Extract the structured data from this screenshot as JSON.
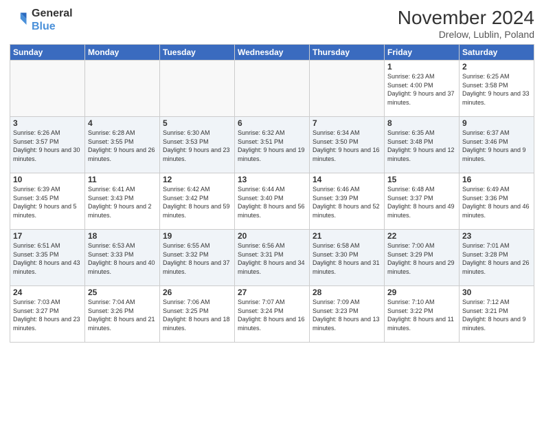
{
  "logo": {
    "line1": "General",
    "line2": "Blue"
  },
  "title": "November 2024",
  "subtitle": "Drelow, Lublin, Poland",
  "weekdays": [
    "Sunday",
    "Monday",
    "Tuesday",
    "Wednesday",
    "Thursday",
    "Friday",
    "Saturday"
  ],
  "weeks": [
    [
      {
        "day": "",
        "sunrise": "",
        "sunset": "",
        "daylight": ""
      },
      {
        "day": "",
        "sunrise": "",
        "sunset": "",
        "daylight": ""
      },
      {
        "day": "",
        "sunrise": "",
        "sunset": "",
        "daylight": ""
      },
      {
        "day": "",
        "sunrise": "",
        "sunset": "",
        "daylight": ""
      },
      {
        "day": "",
        "sunrise": "",
        "sunset": "",
        "daylight": ""
      },
      {
        "day": "1",
        "sunrise": "Sunrise: 6:23 AM",
        "sunset": "Sunset: 4:00 PM",
        "daylight": "Daylight: 9 hours and 37 minutes."
      },
      {
        "day": "2",
        "sunrise": "Sunrise: 6:25 AM",
        "sunset": "Sunset: 3:58 PM",
        "daylight": "Daylight: 9 hours and 33 minutes."
      }
    ],
    [
      {
        "day": "3",
        "sunrise": "Sunrise: 6:26 AM",
        "sunset": "Sunset: 3:57 PM",
        "daylight": "Daylight: 9 hours and 30 minutes."
      },
      {
        "day": "4",
        "sunrise": "Sunrise: 6:28 AM",
        "sunset": "Sunset: 3:55 PM",
        "daylight": "Daylight: 9 hours and 26 minutes."
      },
      {
        "day": "5",
        "sunrise": "Sunrise: 6:30 AM",
        "sunset": "Sunset: 3:53 PM",
        "daylight": "Daylight: 9 hours and 23 minutes."
      },
      {
        "day": "6",
        "sunrise": "Sunrise: 6:32 AM",
        "sunset": "Sunset: 3:51 PM",
        "daylight": "Daylight: 9 hours and 19 minutes."
      },
      {
        "day": "7",
        "sunrise": "Sunrise: 6:34 AM",
        "sunset": "Sunset: 3:50 PM",
        "daylight": "Daylight: 9 hours and 16 minutes."
      },
      {
        "day": "8",
        "sunrise": "Sunrise: 6:35 AM",
        "sunset": "Sunset: 3:48 PM",
        "daylight": "Daylight: 9 hours and 12 minutes."
      },
      {
        "day": "9",
        "sunrise": "Sunrise: 6:37 AM",
        "sunset": "Sunset: 3:46 PM",
        "daylight": "Daylight: 9 hours and 9 minutes."
      }
    ],
    [
      {
        "day": "10",
        "sunrise": "Sunrise: 6:39 AM",
        "sunset": "Sunset: 3:45 PM",
        "daylight": "Daylight: 9 hours and 5 minutes."
      },
      {
        "day": "11",
        "sunrise": "Sunrise: 6:41 AM",
        "sunset": "Sunset: 3:43 PM",
        "daylight": "Daylight: 9 hours and 2 minutes."
      },
      {
        "day": "12",
        "sunrise": "Sunrise: 6:42 AM",
        "sunset": "Sunset: 3:42 PM",
        "daylight": "Daylight: 8 hours and 59 minutes."
      },
      {
        "day": "13",
        "sunrise": "Sunrise: 6:44 AM",
        "sunset": "Sunset: 3:40 PM",
        "daylight": "Daylight: 8 hours and 56 minutes."
      },
      {
        "day": "14",
        "sunrise": "Sunrise: 6:46 AM",
        "sunset": "Sunset: 3:39 PM",
        "daylight": "Daylight: 8 hours and 52 minutes."
      },
      {
        "day": "15",
        "sunrise": "Sunrise: 6:48 AM",
        "sunset": "Sunset: 3:37 PM",
        "daylight": "Daylight: 8 hours and 49 minutes."
      },
      {
        "day": "16",
        "sunrise": "Sunrise: 6:49 AM",
        "sunset": "Sunset: 3:36 PM",
        "daylight": "Daylight: 8 hours and 46 minutes."
      }
    ],
    [
      {
        "day": "17",
        "sunrise": "Sunrise: 6:51 AM",
        "sunset": "Sunset: 3:35 PM",
        "daylight": "Daylight: 8 hours and 43 minutes."
      },
      {
        "day": "18",
        "sunrise": "Sunrise: 6:53 AM",
        "sunset": "Sunset: 3:33 PM",
        "daylight": "Daylight: 8 hours and 40 minutes."
      },
      {
        "day": "19",
        "sunrise": "Sunrise: 6:55 AM",
        "sunset": "Sunset: 3:32 PM",
        "daylight": "Daylight: 8 hours and 37 minutes."
      },
      {
        "day": "20",
        "sunrise": "Sunrise: 6:56 AM",
        "sunset": "Sunset: 3:31 PM",
        "daylight": "Daylight: 8 hours and 34 minutes."
      },
      {
        "day": "21",
        "sunrise": "Sunrise: 6:58 AM",
        "sunset": "Sunset: 3:30 PM",
        "daylight": "Daylight: 8 hours and 31 minutes."
      },
      {
        "day": "22",
        "sunrise": "Sunrise: 7:00 AM",
        "sunset": "Sunset: 3:29 PM",
        "daylight": "Daylight: 8 hours and 29 minutes."
      },
      {
        "day": "23",
        "sunrise": "Sunrise: 7:01 AM",
        "sunset": "Sunset: 3:28 PM",
        "daylight": "Daylight: 8 hours and 26 minutes."
      }
    ],
    [
      {
        "day": "24",
        "sunrise": "Sunrise: 7:03 AM",
        "sunset": "Sunset: 3:27 PM",
        "daylight": "Daylight: 8 hours and 23 minutes."
      },
      {
        "day": "25",
        "sunrise": "Sunrise: 7:04 AM",
        "sunset": "Sunset: 3:26 PM",
        "daylight": "Daylight: 8 hours and 21 minutes."
      },
      {
        "day": "26",
        "sunrise": "Sunrise: 7:06 AM",
        "sunset": "Sunset: 3:25 PM",
        "daylight": "Daylight: 8 hours and 18 minutes."
      },
      {
        "day": "27",
        "sunrise": "Sunrise: 7:07 AM",
        "sunset": "Sunset: 3:24 PM",
        "daylight": "Daylight: 8 hours and 16 minutes."
      },
      {
        "day": "28",
        "sunrise": "Sunrise: 7:09 AM",
        "sunset": "Sunset: 3:23 PM",
        "daylight": "Daylight: 8 hours and 13 minutes."
      },
      {
        "day": "29",
        "sunrise": "Sunrise: 7:10 AM",
        "sunset": "Sunset: 3:22 PM",
        "daylight": "Daylight: 8 hours and 11 minutes."
      },
      {
        "day": "30",
        "sunrise": "Sunrise: 7:12 AM",
        "sunset": "Sunset: 3:21 PM",
        "daylight": "Daylight: 8 hours and 9 minutes."
      }
    ]
  ]
}
